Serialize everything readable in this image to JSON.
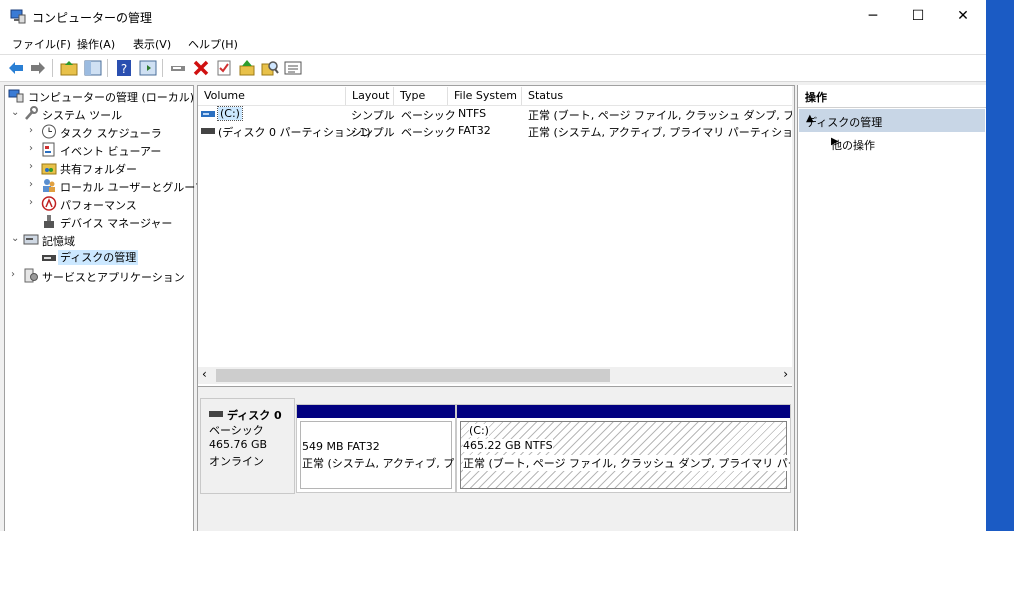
{
  "window": {
    "title": "コンピューターの管理",
    "controls": {
      "minimize": "─",
      "maximize": "☐",
      "close": "✕"
    }
  },
  "menu": [
    "ファイル(F)",
    "操作(A)",
    "表示(V)",
    "ヘルプ(H)"
  ],
  "toolbar": [
    "back-icon",
    "forward-icon",
    "up-folder-icon",
    "show-tree-icon",
    "help-icon",
    "properties-icon",
    "connect-icon",
    "delete-icon",
    "check-icon",
    "import-icon",
    "search-icon",
    "list-icon"
  ],
  "tree": {
    "root": "コンピューターの管理 (ローカル)",
    "system_tools": "システム ツール",
    "task_scheduler": "タスク スケジューラ",
    "event_viewer": "イベント ビューアー",
    "shared_folders": "共有フォルダー",
    "local_users": "ローカル ユーザーとグループ",
    "performance": "パフォーマンス",
    "device_manager": "デバイス マネージャー",
    "storage": "記憶域",
    "disk_management": "ディスクの管理",
    "services_apps": "サービスとアプリケーション"
  },
  "volumes": {
    "columns": [
      "Volume",
      "Layout",
      "Type",
      "File System",
      "Status"
    ],
    "rows": [
      {
        "volume": "(C:)",
        "layout": "シンプル",
        "type": "ベーシック",
        "fs": "NTFS",
        "status": "正常 (ブート, ページ ファイル, クラッシュ ダンプ, プライマリ /"
      },
      {
        "volume": "(ディスク 0 パーティション 1)",
        "layout": "シンプル",
        "type": "ベーシック",
        "fs": "FAT32",
        "status": "正常 (システム, アクティブ, プライマリ パーティション)"
      }
    ]
  },
  "disk": {
    "name": "ディスク 0",
    "type": "ベーシック",
    "size": "465.76 GB",
    "state": "オンライン",
    "partitions": [
      {
        "title": "",
        "line1": "549 MB FAT32",
        "line2": "正常 (システム, アクティブ, プライマリ パーティション)"
      },
      {
        "title": "(C:)",
        "line1": "465.22 GB NTFS",
        "line2": "正常 (ブート, ページ ファイル, クラッシュ ダンプ, プライマリ パーティション)"
      }
    ]
  },
  "actions": {
    "header": "操作",
    "section": "ディスクの管理",
    "more": "他の操作"
  },
  "colors": {
    "partition_bar": "#010080",
    "selection": "#cce8ff",
    "action_section": "#c8d6e6",
    "desktop": "#1b5bc4"
  }
}
